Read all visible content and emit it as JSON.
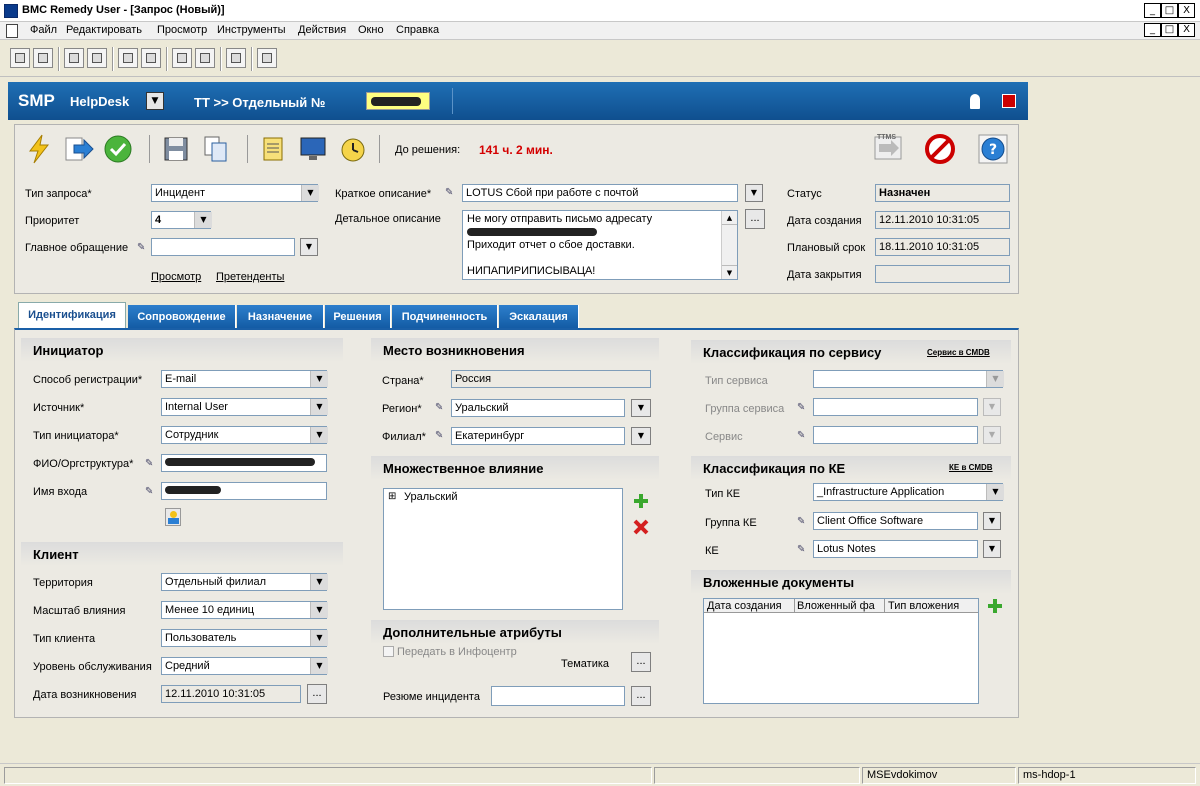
{
  "window": {
    "title": "BMC Remedy User - [Запрос (Новый)]",
    "min": "_",
    "max": "□",
    "close": "X",
    "child_min": "_",
    "child_restore": "□",
    "child_close": "X"
  },
  "menu": [
    "Файл",
    "Редактировать",
    "Просмотр",
    "Инструменты",
    "Действия",
    "Окно",
    "Справка"
  ],
  "header": {
    "logo": "SMP",
    "product": "HelpDesk",
    "dropdown": "▼",
    "title": "TT >> Отдельный №"
  },
  "toolbar": {
    "deadline_label": "До решения:",
    "deadline_value": "141 ч. 2 мин.",
    "ttms": "TTMS"
  },
  "top_form": {
    "request_type_label": "Тип запроса*",
    "request_type": "Инцидент",
    "priority_label": "Приоритет",
    "priority": "4",
    "main_request_label": "Главное обращение",
    "main_request": "",
    "view_link": "Просмотр",
    "candidates_link": "Претенденты",
    "summary_label": "Краткое описание*",
    "summary": "LOTUS  Сбой при работе с почтой",
    "details_label": "Детальное описание",
    "details_line1": "Не могу отправить письмо адресату",
    "details_line3": "Приходит отчет о сбое доставки.",
    "details_line5": "НИПАПИРИПИСЫВАЦА!",
    "status_label": "Статус",
    "status": "Назначен",
    "created_label": "Дата создания",
    "created": "12.11.2010 10:31:05",
    "planned_label": "Плановый срок",
    "planned": "18.11.2010 10:31:05",
    "closed_label": "Дата закрытия",
    "closed": ""
  },
  "tabs": [
    "Идентификация",
    "Сопровождение",
    "Назначение",
    "Решения",
    "Подчиненность",
    "Эскалация"
  ],
  "initiator": {
    "title": "Инициатор",
    "reg_method_label": "Способ регистрации*",
    "reg_method": "E-mail",
    "source_label": "Источник*",
    "source": "Internal User",
    "init_type_label": "Тип инициатора*",
    "init_type": "Сотрудник",
    "fio_label": "ФИО/Оргструктура*",
    "login_label": "Имя входа"
  },
  "client": {
    "title": "Клиент",
    "territory_label": "Территория",
    "territory": "Отдельный филиал",
    "scale_label": "Масштаб влияния",
    "scale": "Менее 10 единиц",
    "client_type_label": "Тип клиента",
    "client_type": "Пользователь",
    "service_level_label": "Уровень обслуживания",
    "service_level": "Средний",
    "occurred_label": "Дата возникновения",
    "occurred": "12.11.2010 10:31:05"
  },
  "location": {
    "title": "Место возникновения",
    "country_label": "Страна*",
    "country": "Россия",
    "region_label": "Регион*",
    "region": "Уральский",
    "branch_label": "Филиал*",
    "branch": "Екатеринбург"
  },
  "impact": {
    "title": "Множественное влияние",
    "tree_expand": "⊞",
    "tree_item": "Уральский"
  },
  "extra": {
    "title": "Дополнительные атрибуты",
    "infocenter": "Передать в Инфоцентр",
    "topic_label": "Тематика",
    "resume_label": "Резюме инцидента"
  },
  "service_class": {
    "title": "Классификация по сервису",
    "cmdb_link": "Сервис в CMDB",
    "service_type_label": "Тип сервиса",
    "service_group_label": "Группа сервиса",
    "service_label": "Сервис"
  },
  "ke_class": {
    "title": "Классификация по КЕ",
    "cmdb_link": "КЕ в CMDB",
    "ke_type_label": "Тип КЕ",
    "ke_type": "_Infrastructure Application",
    "ke_group_label": "Группа КЕ",
    "ke_group": "Client Office Software",
    "ke_label": "КЕ",
    "ke": "Lotus Notes"
  },
  "attachments": {
    "title": "Вложенные документы",
    "col1": "Дата создания",
    "col2": "Вложенный фа",
    "col3": "Тип вложения"
  },
  "statusbar": {
    "user": "MSEvdokimov",
    "server": "ms-hdop-1"
  },
  "colors": {
    "header_blue": "#125aa3",
    "deadline_red": "#d40000"
  }
}
